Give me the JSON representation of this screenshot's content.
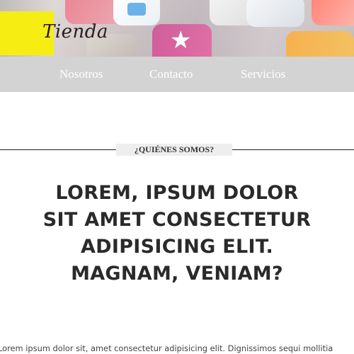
{
  "header": {
    "logo_text": "Tienda"
  },
  "nav": {
    "items": [
      {
        "label": "Nosotros"
      },
      {
        "label": "Contacto"
      },
      {
        "label": "Servicios"
      }
    ]
  },
  "section": {
    "label": "¿QUIÉNES SOMOS?",
    "heading": "LOREM, IPSUM DOLOR SIT AMET CONSECTETUR ADIPISICING ELIT. MAGNAM, VENIAM?",
    "body": "Lorem ipsum dolor sit, amet consectetur adipisicing elit. Dignissimos sequi mollitia"
  },
  "colors": {
    "logo_background": "#f6ee13",
    "navbar_background": "#d3d3d3",
    "nav_text": "#ffffff",
    "heading_text": "#2a2a2a"
  }
}
